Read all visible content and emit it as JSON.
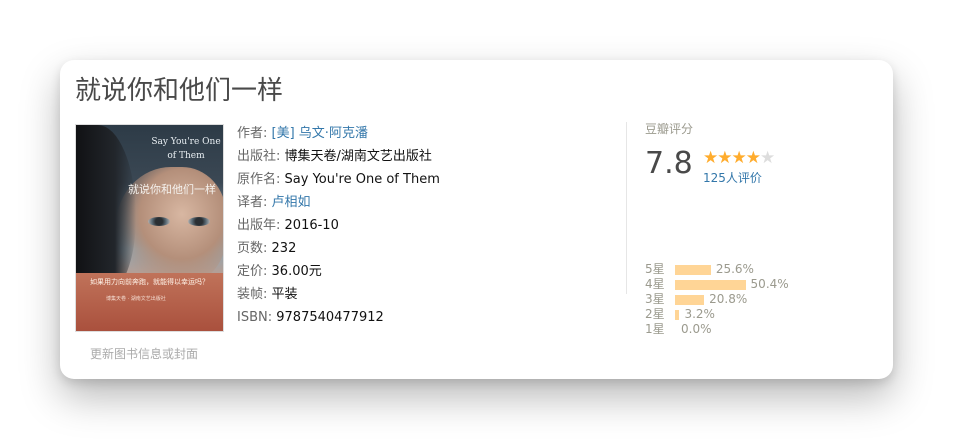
{
  "book": {
    "title": "就说你和他们一样",
    "update_link": "更新图书信息或封面",
    "cover": {
      "en_title": "Say You're One of Them",
      "cn_title": "就说你和他们一样",
      "band_line1": "如果用力向前奔跑，就能得以幸运吗？",
      "band_line2": "博集天卷 · 湖南文艺出版社"
    }
  },
  "info": {
    "author_label": "作者:",
    "author_value": "[美] 乌文·阿克潘",
    "publisher_label": "出版社:",
    "publisher_value": "博集天卷/湖南文艺出版社",
    "original_label": "原作名:",
    "original_value": "Say You're One of Them",
    "translator_label": "译者:",
    "translator_value": "卢相如",
    "year_label": "出版年:",
    "year_value": "2016-10",
    "pages_label": "页数:",
    "pages_value": "232",
    "price_label": "定价:",
    "price_value": "36.00元",
    "binding_label": "装帧:",
    "binding_value": "平装",
    "isbn_label": "ISBN:",
    "isbn_value": "9787540477912"
  },
  "rating": {
    "label": "豆瓣评分",
    "score": "7.8",
    "stars_filled": 4,
    "stars_total": 5,
    "votes": "125人评价",
    "histogram": [
      {
        "label": "5星",
        "percent": 25.6,
        "text": "25.6%"
      },
      {
        "label": "4星",
        "percent": 50.4,
        "text": "50.4%"
      },
      {
        "label": "3星",
        "percent": 20.8,
        "text": "20.8%"
      },
      {
        "label": "2星",
        "percent": 3.2,
        "text": "3.2%"
      },
      {
        "label": "1星",
        "percent": 0.0,
        "text": "0.0%"
      }
    ]
  },
  "colors": {
    "link": "#3377aa",
    "star": "#ffac2d",
    "bar": "#ffd596"
  }
}
